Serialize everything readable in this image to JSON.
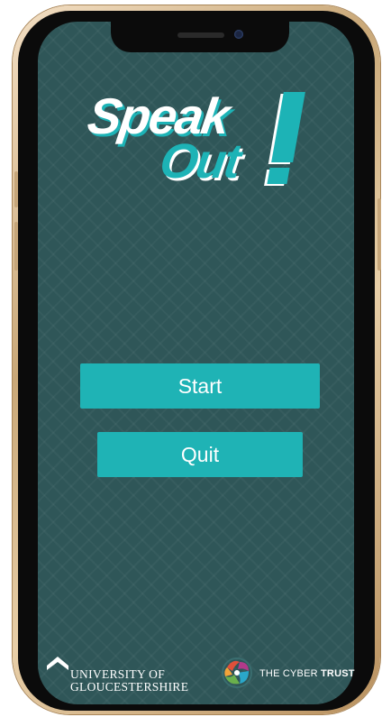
{
  "logo": {
    "line1": "Speak",
    "line2": "Out",
    "accent_color": "#1db3b6"
  },
  "menu": {
    "start_label": "Start",
    "quit_label": "Quit",
    "button_color": "#1fb3b5"
  },
  "footer": {
    "university_line1": "UNIVERSITY OF",
    "university_line2": "GLOUCESTERSHIRE",
    "partner_light": "THE CYBER ",
    "partner_bold": "TRUST"
  },
  "colors": {
    "screen_background": "#2f5658",
    "frame": "#c9a878"
  }
}
